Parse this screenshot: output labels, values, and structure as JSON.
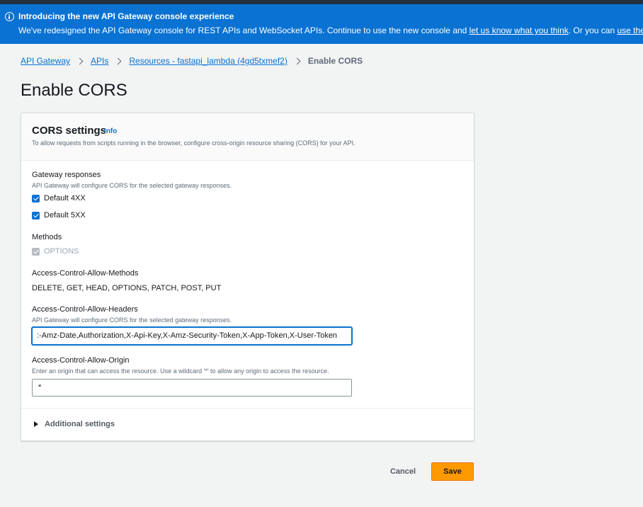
{
  "banner": {
    "icon": "info-icon",
    "title": "Introducing the new API Gateway console experience",
    "text_start": "We've redesigned the API Gateway console for REST APIs and WebSocket APIs. Continue to use the new console and ",
    "feedback_link": "let us know what you think",
    "text_middle": ". Or you can ",
    "old_console_link": "use the old console"
  },
  "breadcrumb": {
    "items": [
      "API Gateway",
      "APIs",
      "Resources - fastapi_lambda (4gd5txmef2)"
    ],
    "current": "Enable CORS"
  },
  "page_title": "Enable CORS",
  "card": {
    "title": "CORS settings",
    "info": "Info",
    "description": "To allow requests from scripts running in the browser, configure cross-origin resource sharing (CORS) for your API."
  },
  "gateway_responses": {
    "label": "Gateway responses",
    "hint": "API Gateway will configure CORS for the selected gateway responses.",
    "options": [
      "Default 4XX",
      "Default 5XX"
    ]
  },
  "methods": {
    "label": "Methods",
    "option": "OPTIONS"
  },
  "allow_methods": {
    "label": "Access-Control-Allow-Methods",
    "value": "DELETE, GET, HEAD, OPTIONS, PATCH, POST, PUT"
  },
  "allow_headers": {
    "label": "Access-Control-Allow-Headers",
    "hint": "API Gateway will configure CORS for the selected gateway responses.",
    "value": ":-Amz-Date,Authorization,X-Api-Key,X-Amz-Security-Token,X-App-Token,X-User-Token"
  },
  "allow_origin": {
    "label": "Access-Control-Allow-Origin",
    "hint": "Enter an origin that can access the resource. Use a wildcard '*' to allow any origin to access the resource.",
    "value": "*"
  },
  "additional_settings": "Additional settings",
  "actions": {
    "cancel": "Cancel",
    "save": "Save"
  },
  "colors": {
    "banner": "#0972d3",
    "primary_button": "#ff9900",
    "link": "#0972d3"
  }
}
